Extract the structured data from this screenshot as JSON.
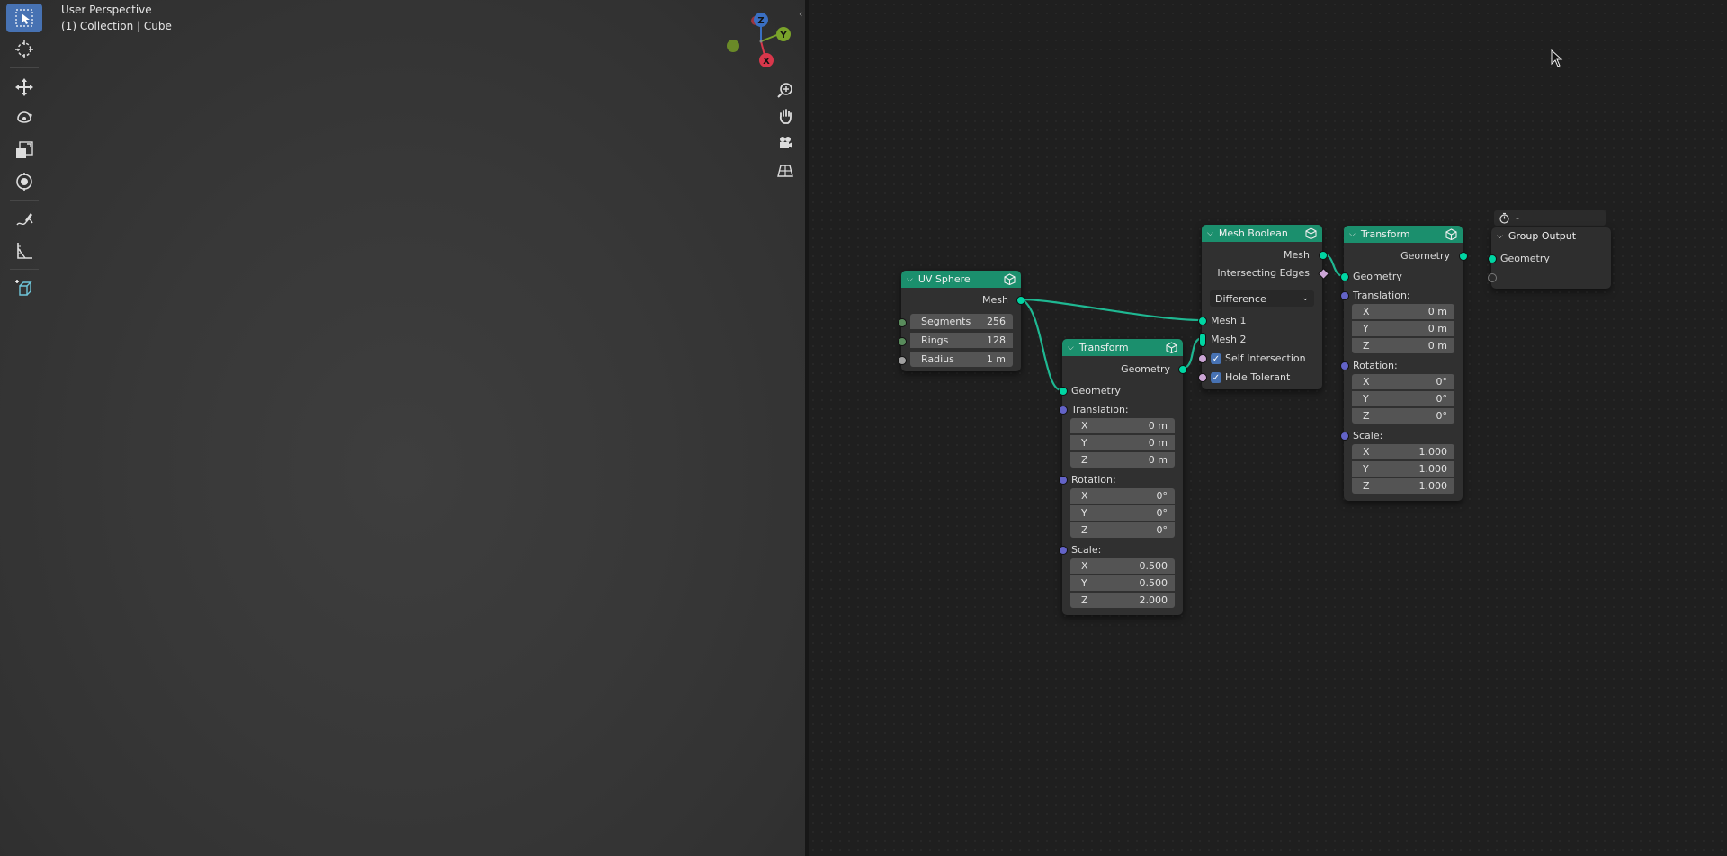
{
  "viewport": {
    "title": "User Perspective",
    "subtitle": "(1) Collection | Cube",
    "tools": [
      "select-box-icon",
      "cursor-icon",
      "move-icon",
      "rotate-icon",
      "scale-icon",
      "transform-icon",
      "annotate-icon",
      "measure-icon",
      "add-cube-icon"
    ],
    "gizmo": {
      "z": "Z",
      "y": "Y",
      "x": "X"
    }
  },
  "nodes": {
    "uv_sphere": {
      "title": "UV Sphere",
      "output": "Mesh",
      "fields": [
        {
          "label": "Segments",
          "value": "256"
        },
        {
          "label": "Rings",
          "value": "128"
        },
        {
          "label": "Radius",
          "value": "1 m"
        }
      ]
    },
    "transform1": {
      "title": "Transform",
      "output": "Geometry",
      "input": "Geometry",
      "translation_label": "Translation:",
      "translation": [
        {
          "axis": "X",
          "value": "0 m"
        },
        {
          "axis": "Y",
          "value": "0 m"
        },
        {
          "axis": "Z",
          "value": "0 m"
        }
      ],
      "rotation_label": "Rotation:",
      "rotation": [
        {
          "axis": "X",
          "value": "0°"
        },
        {
          "axis": "Y",
          "value": "0°"
        },
        {
          "axis": "Z",
          "value": "0°"
        }
      ],
      "scale_label": "Scale:",
      "scale": [
        {
          "axis": "X",
          "value": "0.500"
        },
        {
          "axis": "Y",
          "value": "0.500"
        },
        {
          "axis": "Z",
          "value": "2.000"
        }
      ]
    },
    "mesh_boolean": {
      "title": "Mesh Boolean",
      "output_mesh": "Mesh",
      "output_edges": "Intersecting Edges",
      "operation": "Difference",
      "input_mesh1": "Mesh 1",
      "input_mesh2": "Mesh 2",
      "self_intersection": "Self Intersection",
      "hole_tolerant": "Hole Tolerant"
    },
    "transform2": {
      "title": "Transform",
      "output": "Geometry",
      "input": "Geometry",
      "translation_label": "Translation:",
      "translation": [
        {
          "axis": "X",
          "value": "0 m"
        },
        {
          "axis": "Y",
          "value": "0 m"
        },
        {
          "axis": "Z",
          "value": "0 m"
        }
      ],
      "rotation_label": "Rotation:",
      "rotation": [
        {
          "axis": "X",
          "value": "0°"
        },
        {
          "axis": "Y",
          "value": "0°"
        },
        {
          "axis": "Z",
          "value": "0°"
        }
      ],
      "scale_label": "Scale:",
      "scale": [
        {
          "axis": "X",
          "value": "1.000"
        },
        {
          "axis": "Y",
          "value": "1.000"
        },
        {
          "axis": "Z",
          "value": "1.000"
        }
      ]
    },
    "group_output": {
      "title": "Group Output",
      "timer_value": "-",
      "input": "Geometry"
    }
  },
  "colors": {
    "node_header": "#1b8f6d",
    "geometry_socket": "#00d6a3",
    "vector_socket": "#6363c7",
    "accent": "#4772b3"
  }
}
